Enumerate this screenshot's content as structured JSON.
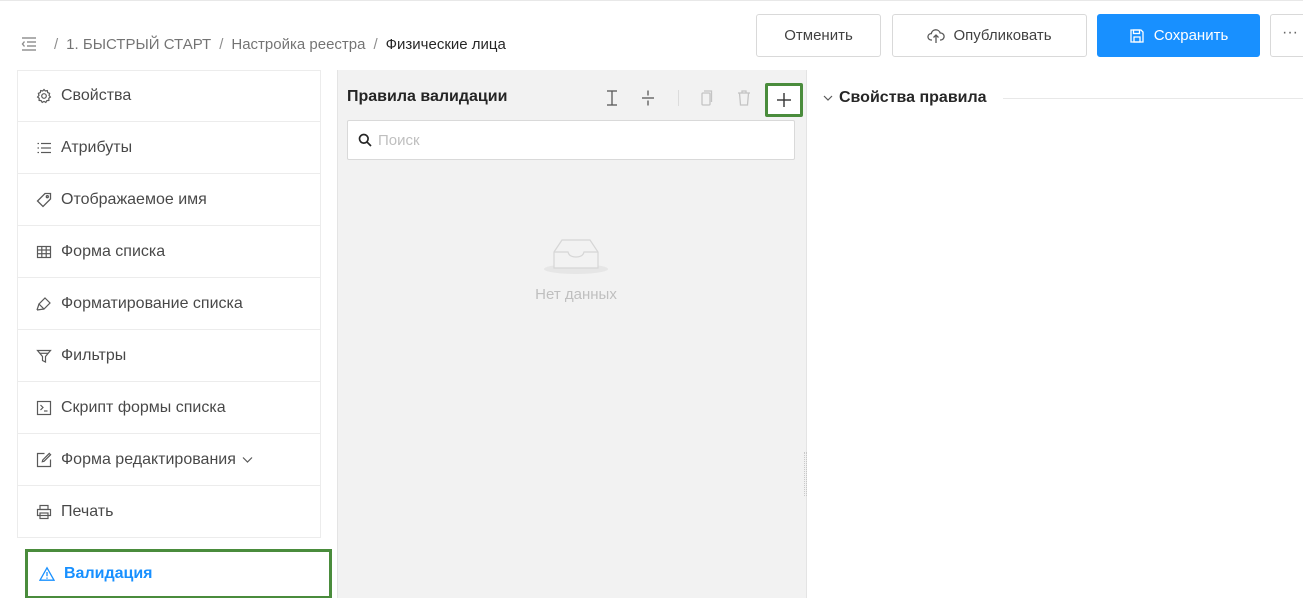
{
  "breadcrumb": {
    "items": [
      "1. БЫСТРЫЙ СТАРТ",
      "Настройка реестра"
    ],
    "separator": "/",
    "current": "Физические лица"
  },
  "toolbar": {
    "cancel_label": "Отменить",
    "publish_label": "Опубликовать",
    "save_label": "Сохранить",
    "more_label": "···"
  },
  "sidebar": {
    "items": [
      {
        "label": "Свойства",
        "icon": "settings-icon"
      },
      {
        "label": "Атрибуты",
        "icon": "list-icon"
      },
      {
        "label": "Отображаемое имя",
        "icon": "tag-icon"
      },
      {
        "label": "Форма списка",
        "icon": "table-icon"
      },
      {
        "label": "Форматирование списка",
        "icon": "highlight-icon"
      },
      {
        "label": "Фильтры",
        "icon": "filter-icon"
      },
      {
        "label": "Скрипт формы списка",
        "icon": "code-icon"
      },
      {
        "label": "Форма редактирования",
        "icon": "edit-icon"
      },
      {
        "label": "Печать",
        "icon": "printer-icon"
      },
      {
        "label": "Валидация",
        "icon": "warning-icon",
        "active": true
      }
    ]
  },
  "rules_panel": {
    "title": "Правила валидации",
    "search_placeholder": "Поиск",
    "empty_text": "Нет данных"
  },
  "properties_panel": {
    "title": "Свойства правила"
  },
  "colors": {
    "primary": "#1890ff",
    "highlight_border": "#4a8c3c",
    "panel_bg": "#f2f2f2"
  }
}
